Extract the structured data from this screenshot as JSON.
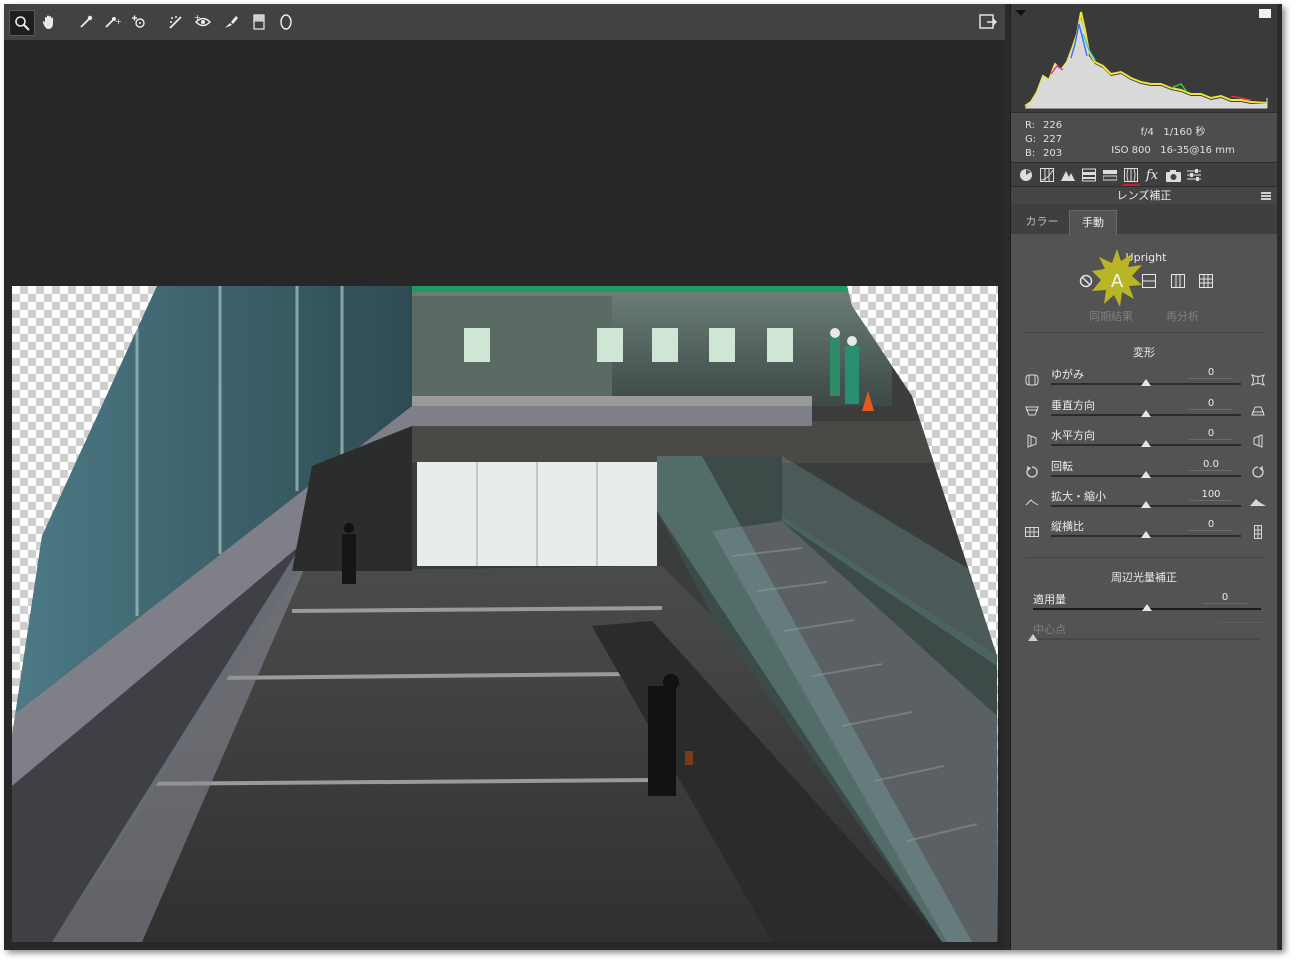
{
  "toolbar": {
    "tools": [
      {
        "name": "zoom-tool",
        "icon": "magnifier-icon",
        "active": true
      },
      {
        "name": "hand-tool",
        "icon": "hand-icon"
      },
      {
        "name": "white-balance-tool",
        "icon": "eyedropper-icon"
      },
      {
        "name": "color-sampler-tool",
        "icon": "color-sampler-icon"
      },
      {
        "name": "targeted-adjustment-tool",
        "icon": "target-adjust-icon"
      },
      {
        "name": "straighten-tool",
        "icon": "straighten-icon"
      },
      {
        "name": "spot-removal-tool",
        "icon": "spot-removal-icon"
      },
      {
        "name": "red-eye-tool",
        "icon": "red-eye-icon"
      },
      {
        "name": "adjustment-brush-tool",
        "icon": "brush-icon"
      },
      {
        "name": "graduated-filter-tool",
        "icon": "graduated-filter-icon"
      },
      {
        "name": "radial-filter-tool",
        "icon": "radial-filter-icon"
      }
    ],
    "right_icon": "open-preferences-icon"
  },
  "info": {
    "r_label": "R:",
    "r_value": "226",
    "g_label": "G:",
    "g_value": "227",
    "b_label": "B:",
    "b_value": "203",
    "aperture": "f/4",
    "shutter": "1/160 秒",
    "iso": "ISO 800",
    "lens": "16-35@16 mm"
  },
  "panel": {
    "title": "レンズ補正",
    "tabs": [
      "カラー",
      "手動"
    ],
    "active_tab": "手動",
    "upright": {
      "label": "Upright",
      "buttons": [
        "off",
        "auto",
        "level",
        "vertical",
        "full"
      ],
      "auto_glyph": "A",
      "sync_label": "同期結果",
      "reanalyze_label": "再分析"
    },
    "transform": {
      "title": "変形",
      "sliders": [
        {
          "label": "ゆがみ",
          "value": "0",
          "position": 0.5
        },
        {
          "label": "垂直方向",
          "value": "0",
          "position": 0.5
        },
        {
          "label": "水平方向",
          "value": "0",
          "position": 0.5
        },
        {
          "label": "回転",
          "value": "0.0",
          "position": 0.5
        },
        {
          "label": "拡大・縮小",
          "value": "100",
          "position": 0.5
        },
        {
          "label": "縦横比",
          "value": "0",
          "position": 0.5
        }
      ]
    },
    "vignette": {
      "title": "周辺光量補正",
      "amount_label": "適用量",
      "amount_value": "0",
      "amount_position": 0.5,
      "midpoint_label": "中心点",
      "midpoint_value": "",
      "midpoint_position": 0.0
    }
  },
  "colors": {
    "accent_red": "#d21d1d",
    "burst": "#b9b524"
  }
}
